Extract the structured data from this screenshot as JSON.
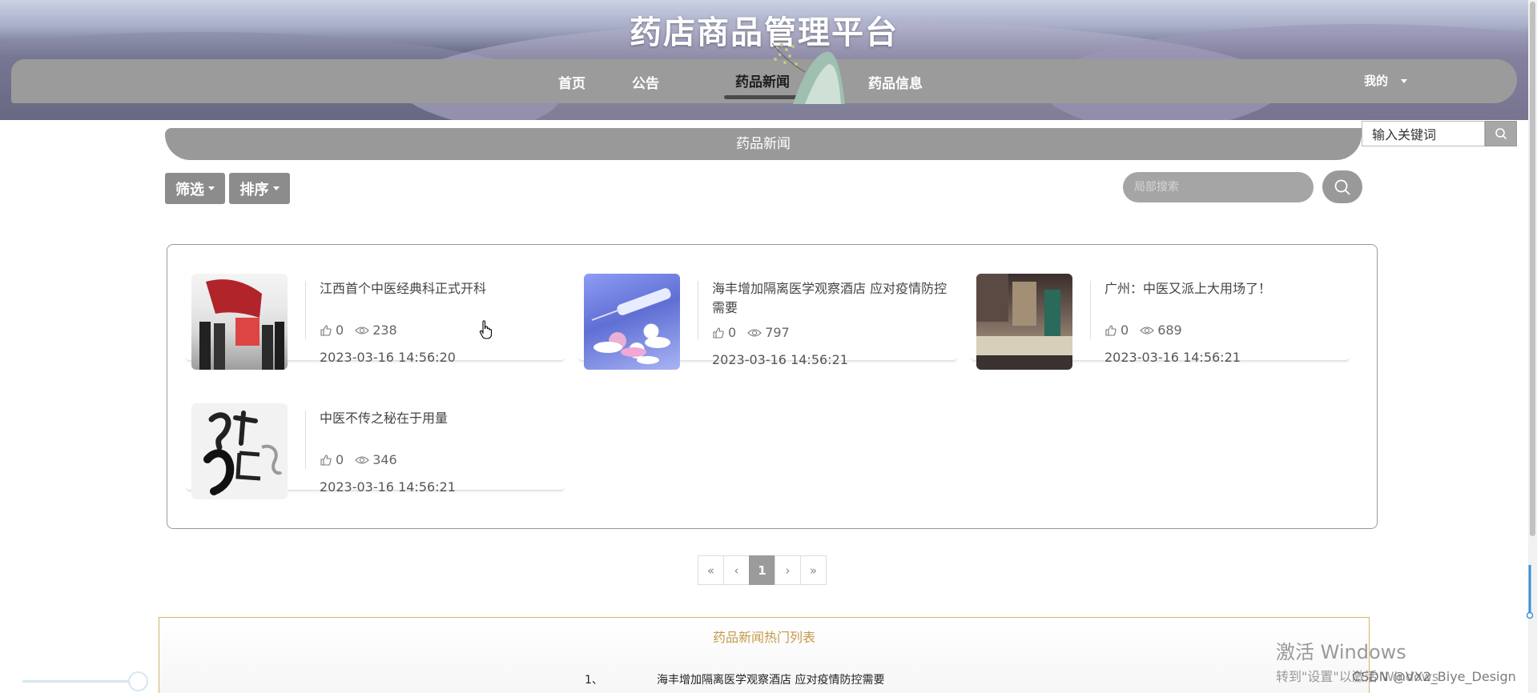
{
  "site": {
    "title": "药店商品管理平台"
  },
  "nav": {
    "items": [
      "首页",
      "公告",
      "药品新闻",
      "药品信息"
    ],
    "active": "药品新闻",
    "mine_label": "我的"
  },
  "top_search": {
    "value": "输入关键词"
  },
  "section": {
    "title": "药品新闻"
  },
  "filters": {
    "filter_label": "筛选",
    "sort_label": "排序"
  },
  "local_search": {
    "placeholder": "局部搜索"
  },
  "news": [
    {
      "title": "江西首个中医经典科正式开科",
      "likes": "0",
      "views": "238",
      "date": "2023-03-16 14:56:20"
    },
    {
      "title": "海丰增加隔离医学观察酒店 应对疫情防控需要",
      "likes": "0",
      "views": "797",
      "date": "2023-03-16 14:56:21"
    },
    {
      "title": "广州：中医又派上大用场了！",
      "likes": "0",
      "views": "689",
      "date": "2023-03-16 14:56:21"
    },
    {
      "title": "中医不传之秘在于用量",
      "likes": "0",
      "views": "346",
      "date": "2023-03-16 14:56:21"
    }
  ],
  "pagination": {
    "first": "«",
    "prev": "‹",
    "current": "1",
    "next": "›",
    "last": "»"
  },
  "hot_list": {
    "title": "药品新闻热门列表",
    "items": [
      {
        "rank": "1、",
        "title": "海丰增加隔离医学观察酒店 应对疫情防控需要"
      }
    ]
  },
  "overlay": {
    "watermark_line1": "激活 Windows",
    "watermark_line2": "转到\"设置\"以激活 Windows",
    "csdn": "CSDN @VX2_Biye_Design"
  },
  "colors": {
    "nav_bg": "#9b9b9b",
    "accent_gold": "#c49a4a",
    "header_dark": "#3e3f55"
  }
}
